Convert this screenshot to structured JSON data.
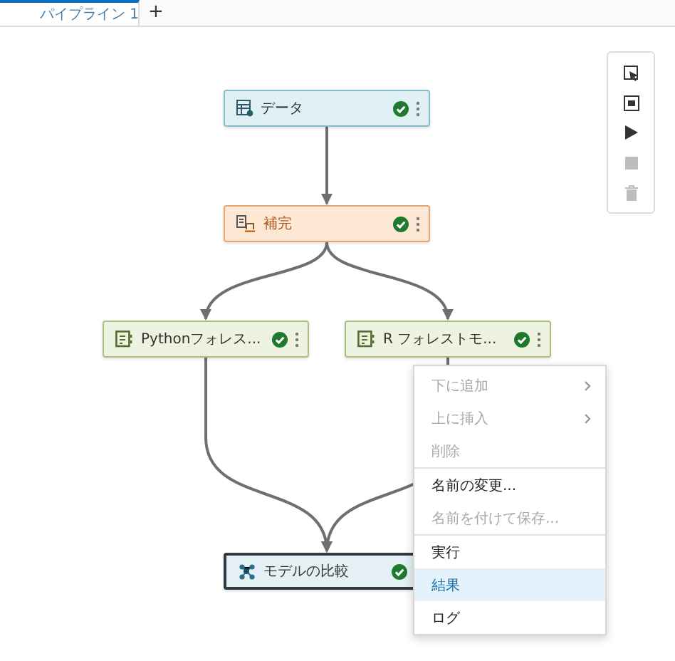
{
  "tabs": [
    {
      "label": "パイプライン 1",
      "selected": true
    }
  ],
  "add_tab": "+",
  "nodes": [
    {
      "label": "データ",
      "kind": "data",
      "completed": true,
      "selected": false
    },
    {
      "label": "補完",
      "kind": "prep",
      "completed": true,
      "selected": false
    },
    {
      "label": "Pythonフォレス...",
      "kind": "model",
      "completed": true,
      "selected": false
    },
    {
      "label": "R フォレストモ...",
      "kind": "model",
      "completed": true,
      "selected": false
    },
    {
      "label": "モデルの比較",
      "kind": "compare",
      "completed": true,
      "selected": true
    }
  ],
  "toolbar": [
    {
      "kind": "select",
      "disabled": false
    },
    {
      "kind": "frame",
      "disabled": false
    },
    {
      "kind": "run",
      "disabled": false
    },
    {
      "kind": "stop",
      "disabled": true
    },
    {
      "kind": "delete",
      "disabled": true
    }
  ],
  "context_menu": {
    "sections": [
      [
        {
          "label": "下に追加",
          "disabled": true,
          "submenu": true,
          "selected": false
        },
        {
          "label": "上に挿入",
          "disabled": true,
          "submenu": true,
          "selected": false
        },
        {
          "label": "削除",
          "disabled": true,
          "submenu": false,
          "selected": false
        }
      ],
      [
        {
          "label": "名前の変更...",
          "disabled": false,
          "submenu": false,
          "selected": false
        },
        {
          "label": "名前を付けて保存...",
          "disabled": true,
          "submenu": false,
          "selected": false
        }
      ],
      [
        {
          "label": "実行",
          "disabled": false,
          "submenu": false,
          "selected": false
        },
        {
          "label": "結果",
          "disabled": false,
          "submenu": false,
          "selected": true
        },
        {
          "label": "ログ",
          "disabled": false,
          "submenu": false,
          "selected": false
        }
      ]
    ]
  }
}
